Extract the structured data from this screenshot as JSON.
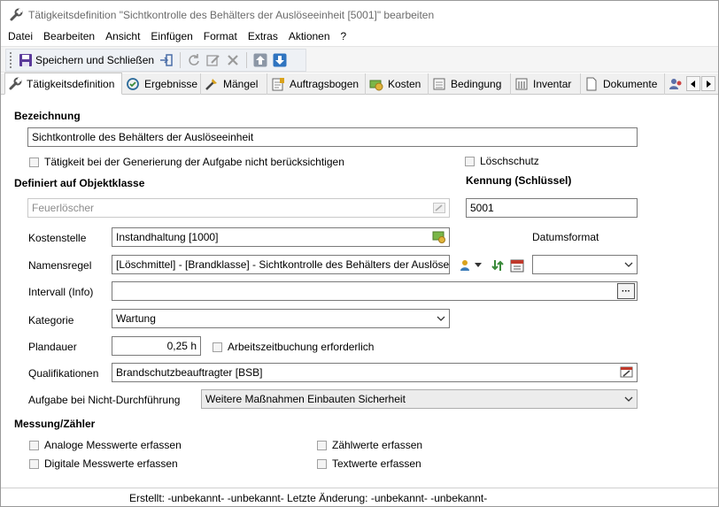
{
  "window": {
    "title": "Tätigkeitsdefinition \"Sichtkontrolle des Behälters der Auslöseeinheit [5001]\" bearbeiten"
  },
  "menu": [
    {
      "label": "Datei"
    },
    {
      "label": "Bearbeiten"
    },
    {
      "label": "Ansicht"
    },
    {
      "label": "Einfügen"
    },
    {
      "label": "Format"
    },
    {
      "label": "Extras"
    },
    {
      "label": "Aktionen"
    },
    {
      "label": "?"
    }
  ],
  "toolbar": {
    "save_close_label": "Speichern und Schließen"
  },
  "tabs": [
    {
      "label": "Tätigkeitsdefinition"
    },
    {
      "label": "Ergebnisse"
    },
    {
      "label": "Mängel"
    },
    {
      "label": "Auftragsbogen"
    },
    {
      "label": "Kosten"
    },
    {
      "label": "Bedingung"
    },
    {
      "label": "Inventar"
    },
    {
      "label": "Dokumente"
    }
  ],
  "form": {
    "bezeichnung_label": "Bezeichnung",
    "bezeichnung_value": "Sichtkontrolle des Behälters der Auslöseeinheit",
    "ignore_generation_label": "Tätigkeit bei der Generierung der Aufgabe nicht berücksichtigen",
    "loeschschutz_label": "Löschschutz",
    "objektklasse_label": "Definiert auf Objektklasse",
    "objektklasse_value": "Feuerlöscher",
    "kennung_label": "Kennung (Schlüssel)",
    "kennung_value": "5001",
    "kostenstelle_label": "Kostenstelle",
    "kostenstelle_value": "Instandhaltung [1000]",
    "datumsformat_label": "Datumsformat",
    "datumsformat_value": "",
    "namensregel_label": "Namensregel",
    "namensregel_value": "[Löschmittel] - [Brandklasse] - Sichtkontrolle des Behälters der Auslöseeinheit",
    "intervall_label": "Intervall (Info)",
    "intervall_value": "",
    "kategorie_label": "Kategorie",
    "kategorie_value": "Wartung",
    "plandauer_label": "Plandauer",
    "plandauer_value": "0,25 h",
    "arbeitszeit_label": "Arbeitszeitbuchung erforderlich",
    "qualifikationen_label": "Qualifikationen",
    "qualifikationen_value": "Brandschutzbeauftragter [BSB]",
    "nicht_durchfuehrung_label": "Aufgabe bei Nicht-Durchführung",
    "nicht_durchfuehrung_value": "Weitere Maßnahmen Einbauten Sicherheit",
    "messung_label": "Messung/Zähler",
    "analoge_label": "Analoge Messwerte erfassen",
    "digitale_label": "Digitale Messwerte erfassen",
    "zaehlwerte_label": "Zählwerte erfassen",
    "textwerte_label": "Textwerte erfassen",
    "intervall_button": "···"
  },
  "status": {
    "text": "Erstellt: -unbekannt- -unbekannt-  Letzte Änderung: -unbekannt- -unbekannt-"
  },
  "colors": {
    "accent_blue": "#2f74c0",
    "save_purple": "#5b3a9a"
  }
}
